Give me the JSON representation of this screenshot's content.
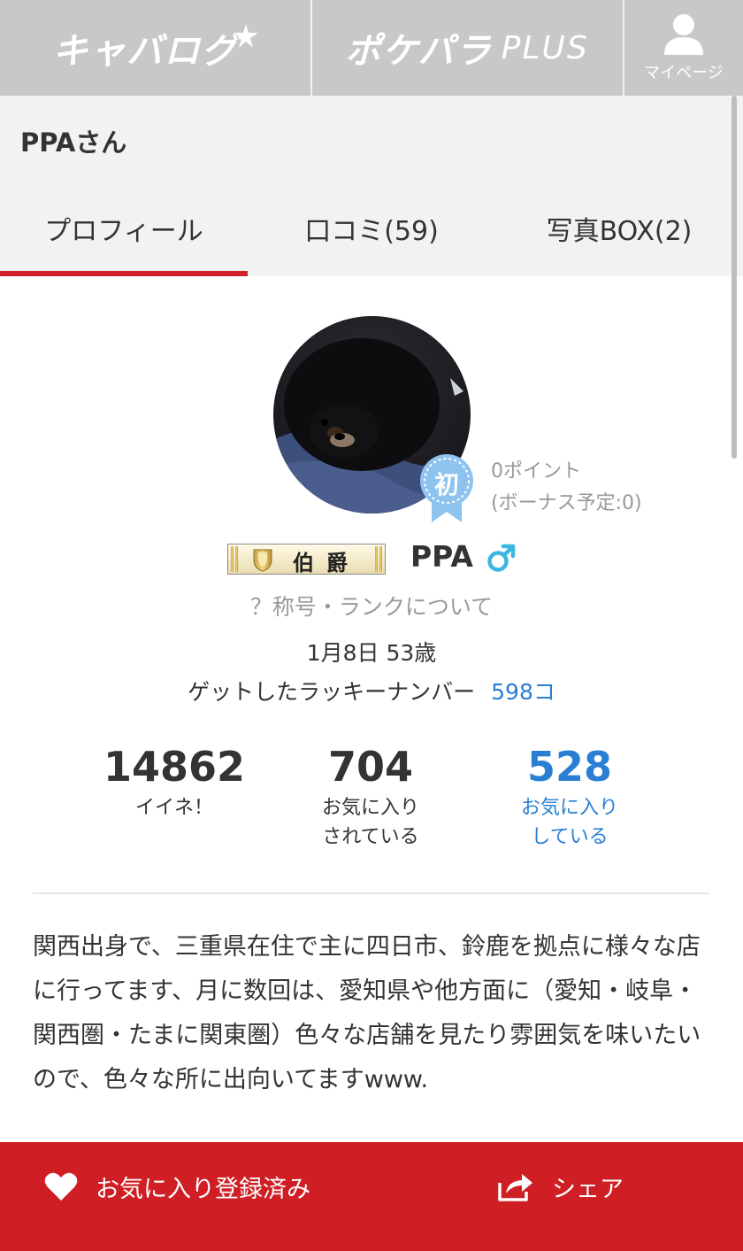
{
  "nav": {
    "logo1": "キャバログ",
    "logo2": "ポケパラ",
    "logo2_plus": "PLUS",
    "mypage_label": "マイページ"
  },
  "user_header": {
    "name": "PPAさん"
  },
  "tabs": [
    {
      "label": "プロフィール",
      "active": true
    },
    {
      "label": "口コミ(59)"
    },
    {
      "label": "写真BOX(2)"
    }
  ],
  "profile": {
    "rank_badge": "初",
    "points": "0ポイント",
    "bonus": "(ボーナス予定:0)",
    "title_plate": "伯爵",
    "name": "PPA",
    "gender": "male-icon",
    "rank_link": "？称号・ランクについて",
    "birthday_age": "1月8日 53歳",
    "lucky_label": "ゲットしたラッキーナンバー",
    "lucky_count": "598コ"
  },
  "stats": [
    {
      "value": "14862",
      "label1": "イイネ！",
      "label2": ""
    },
    {
      "value": "704",
      "label1": "お気に入り",
      "label2": "されている"
    },
    {
      "value": "528",
      "label1": "お気に入り",
      "label2": "している"
    }
  ],
  "bio": "関西出身で、三重県在住で主に四日市、鈴鹿を拠点に様々な店に行ってます、月に数回は、愛知県や他方面に（愛知・岐阜・関西圏・たまに関東圏）色々な店舗を見たり雰囲気を味いたいので、色々な所に出向いてますwww.",
  "bottom_bar": {
    "favorite_label": "お気に入り登録済み",
    "share_label": "シェア"
  },
  "colors": {
    "accent_red": "#d0202a",
    "link_blue": "#2a7fd4",
    "nav_gray": "#c8c8c8",
    "badge_blue": "#8fc3ef"
  }
}
